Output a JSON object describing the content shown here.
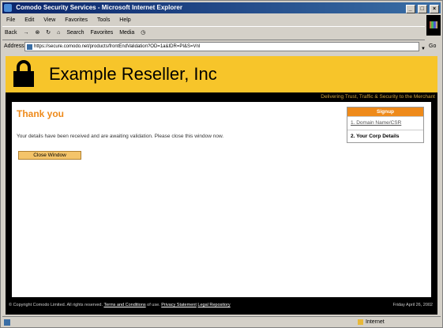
{
  "window": {
    "title": "Comodo Security Services - Microsoft Internet Explorer",
    "minimize": "_",
    "maximize": "□",
    "close": "×"
  },
  "menu": [
    "File",
    "Edit",
    "View",
    "Favorites",
    "Tools",
    "Help"
  ],
  "toolbar": {
    "back": "Back",
    "forward": "→",
    "stop": "⊗",
    "refresh": "↻",
    "home": "⌂",
    "search": "Search",
    "favorites": "Favorites",
    "media": "Media",
    "history": "◷"
  },
  "address": {
    "label": "Address",
    "url": "https://secure.comodo.net/products/frontEndValidation?OD=1a&IDR=PI&S=Vnl",
    "go": "Go"
  },
  "brand": {
    "company": "Example Reseller, Inc",
    "tagline": "Delivering Trust, Traffic & Security to the Merchant"
  },
  "main": {
    "heading": "Thank you",
    "message": "Your details have been received and are awaiting validation. Please close this window now.",
    "close_button": "Close Window"
  },
  "signup": {
    "title": "Signup",
    "steps": [
      "1. Domain Name/CSR",
      "2. Your Corp Details"
    ]
  },
  "footer": {
    "copyright": "© Copyright Comodo Limited. All rights reserved.",
    "terms": "Terms and Conditions",
    "of_use": "of use.",
    "privacy": "Privacy Statement",
    "legal": "Legal Repository",
    "date": "Friday April 26, 2002"
  },
  "status": {
    "text": "",
    "zone": "Internet"
  }
}
